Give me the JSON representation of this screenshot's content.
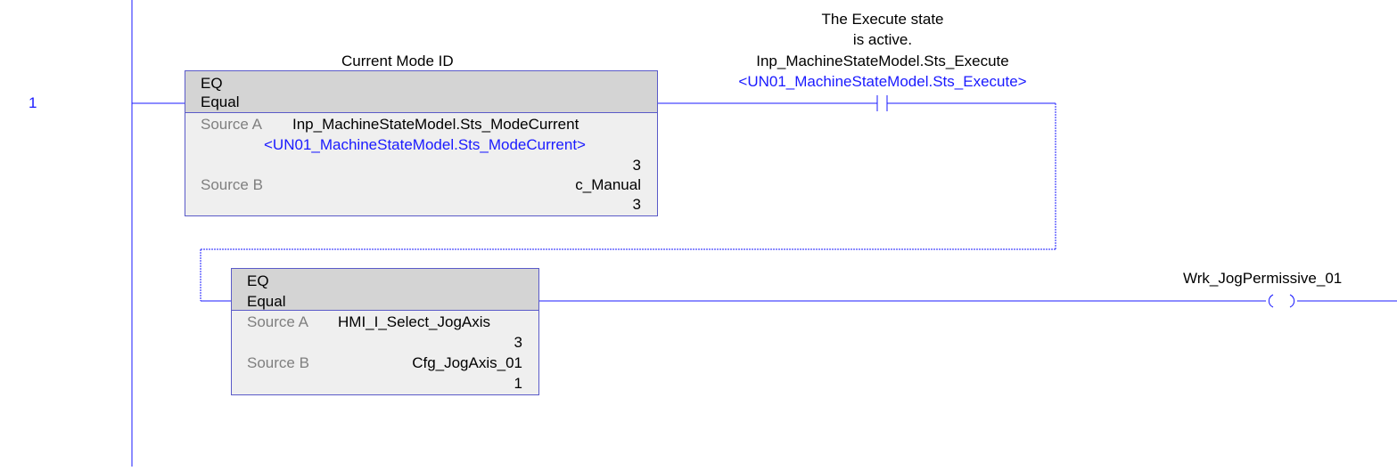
{
  "rung": {
    "number": "1"
  },
  "comments": {
    "eq1_description": "Current Mode ID",
    "xic_description_line1": "The Execute state",
    "xic_description_line2": "is active."
  },
  "eq1": {
    "mnemonic": "EQ",
    "name": "Equal",
    "source_a_label": "Source A",
    "source_a_tag": "Inp_MachineStateModel.Sts_ModeCurrent",
    "source_a_alias": "<UN01_MachineStateModel.Sts_ModeCurrent>",
    "source_a_value": "3",
    "source_b_label": "Source B",
    "source_b_tag": "c_Manual",
    "source_b_value": "3"
  },
  "xic": {
    "tag": "Inp_MachineStateModel.Sts_Execute",
    "alias": "<UN01_MachineStateModel.Sts_Execute>"
  },
  "eq2": {
    "mnemonic": "EQ",
    "name": "Equal",
    "source_a_label": "Source A",
    "source_a_tag": "HMI_I_Select_JogAxis",
    "source_a_value": "3",
    "source_b_label": "Source B",
    "source_b_tag": "Cfg_JogAxis_01",
    "source_b_value": "1"
  },
  "ote": {
    "tag": "Wrk_JogPermissive_01"
  },
  "colors": {
    "wire": "#1a1aff",
    "alias_text": "#1a1aff",
    "block_border": "#5a5ac8",
    "block_header": "#d4d4d4",
    "block_body": "#efefef"
  }
}
